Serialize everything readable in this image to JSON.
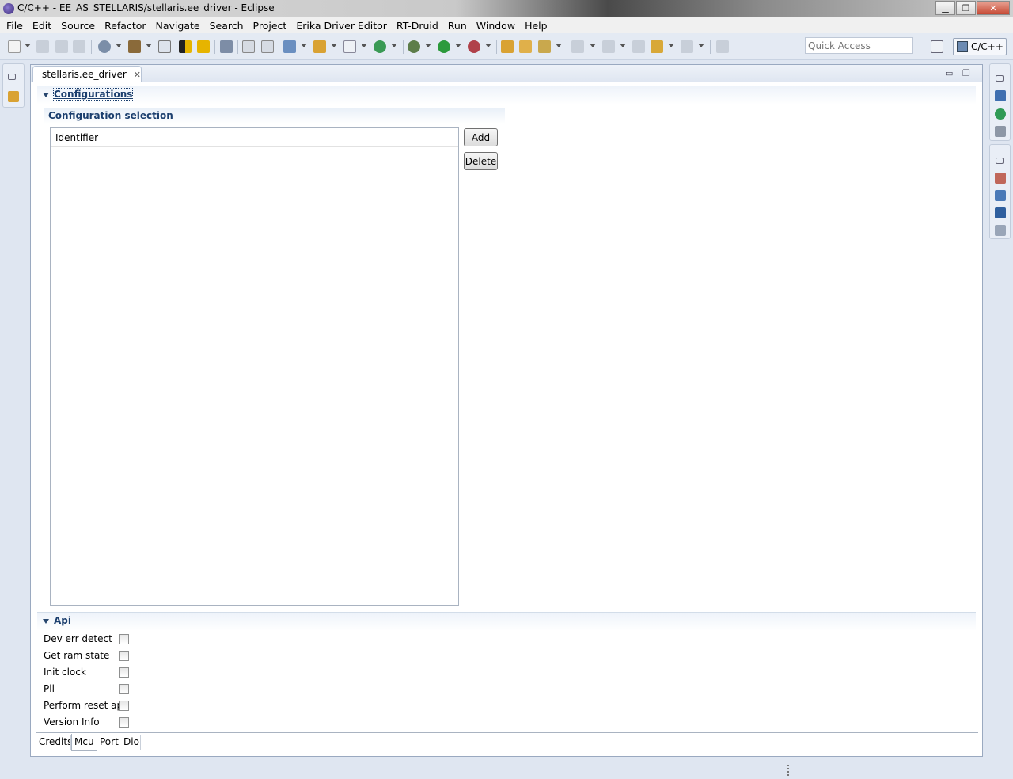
{
  "window": {
    "title": "C/C++ - EE_AS_STELLARIS/stellaris.ee_driver - Eclipse",
    "minimize": "▁",
    "maximize": "❐",
    "close": "✕"
  },
  "menubar": {
    "items": [
      "File",
      "Edit",
      "Source",
      "Refactor",
      "Navigate",
      "Search",
      "Project",
      "Erika Driver Editor",
      "RT-Druid",
      "Run",
      "Window",
      "Help"
    ]
  },
  "toolbar": {
    "quick_access_placeholder": "Quick Access",
    "perspective_label": "C/C++"
  },
  "editor": {
    "tab_label": "stellaris.ee_driver",
    "tab_close": "✕",
    "minimize": "▭",
    "maximize": "❐",
    "configurations": {
      "title": "Configurations",
      "group_title": "Configuration selection",
      "table_columns": [
        "Identifier"
      ],
      "table_rows": [],
      "add_label": "Add",
      "delete_label": "Delete"
    },
    "api": {
      "title": "Api",
      "options": [
        {
          "label": "Dev err detect",
          "checked": false
        },
        {
          "label": "Get ram state",
          "checked": false
        },
        {
          "label": "Init clock",
          "checked": false
        },
        {
          "label": "Pll",
          "checked": false
        },
        {
          "label": "Perform reset api",
          "checked": false
        },
        {
          "label": "Version Info",
          "checked": false
        }
      ]
    },
    "bottom_tabs": [
      "Credits",
      "Mcu",
      "Port",
      "Dio"
    ],
    "active_bottom_tab": "Mcu"
  },
  "colors": {
    "section_title": "#1c3f6e",
    "workbench_bg": "#dfe6f1"
  }
}
